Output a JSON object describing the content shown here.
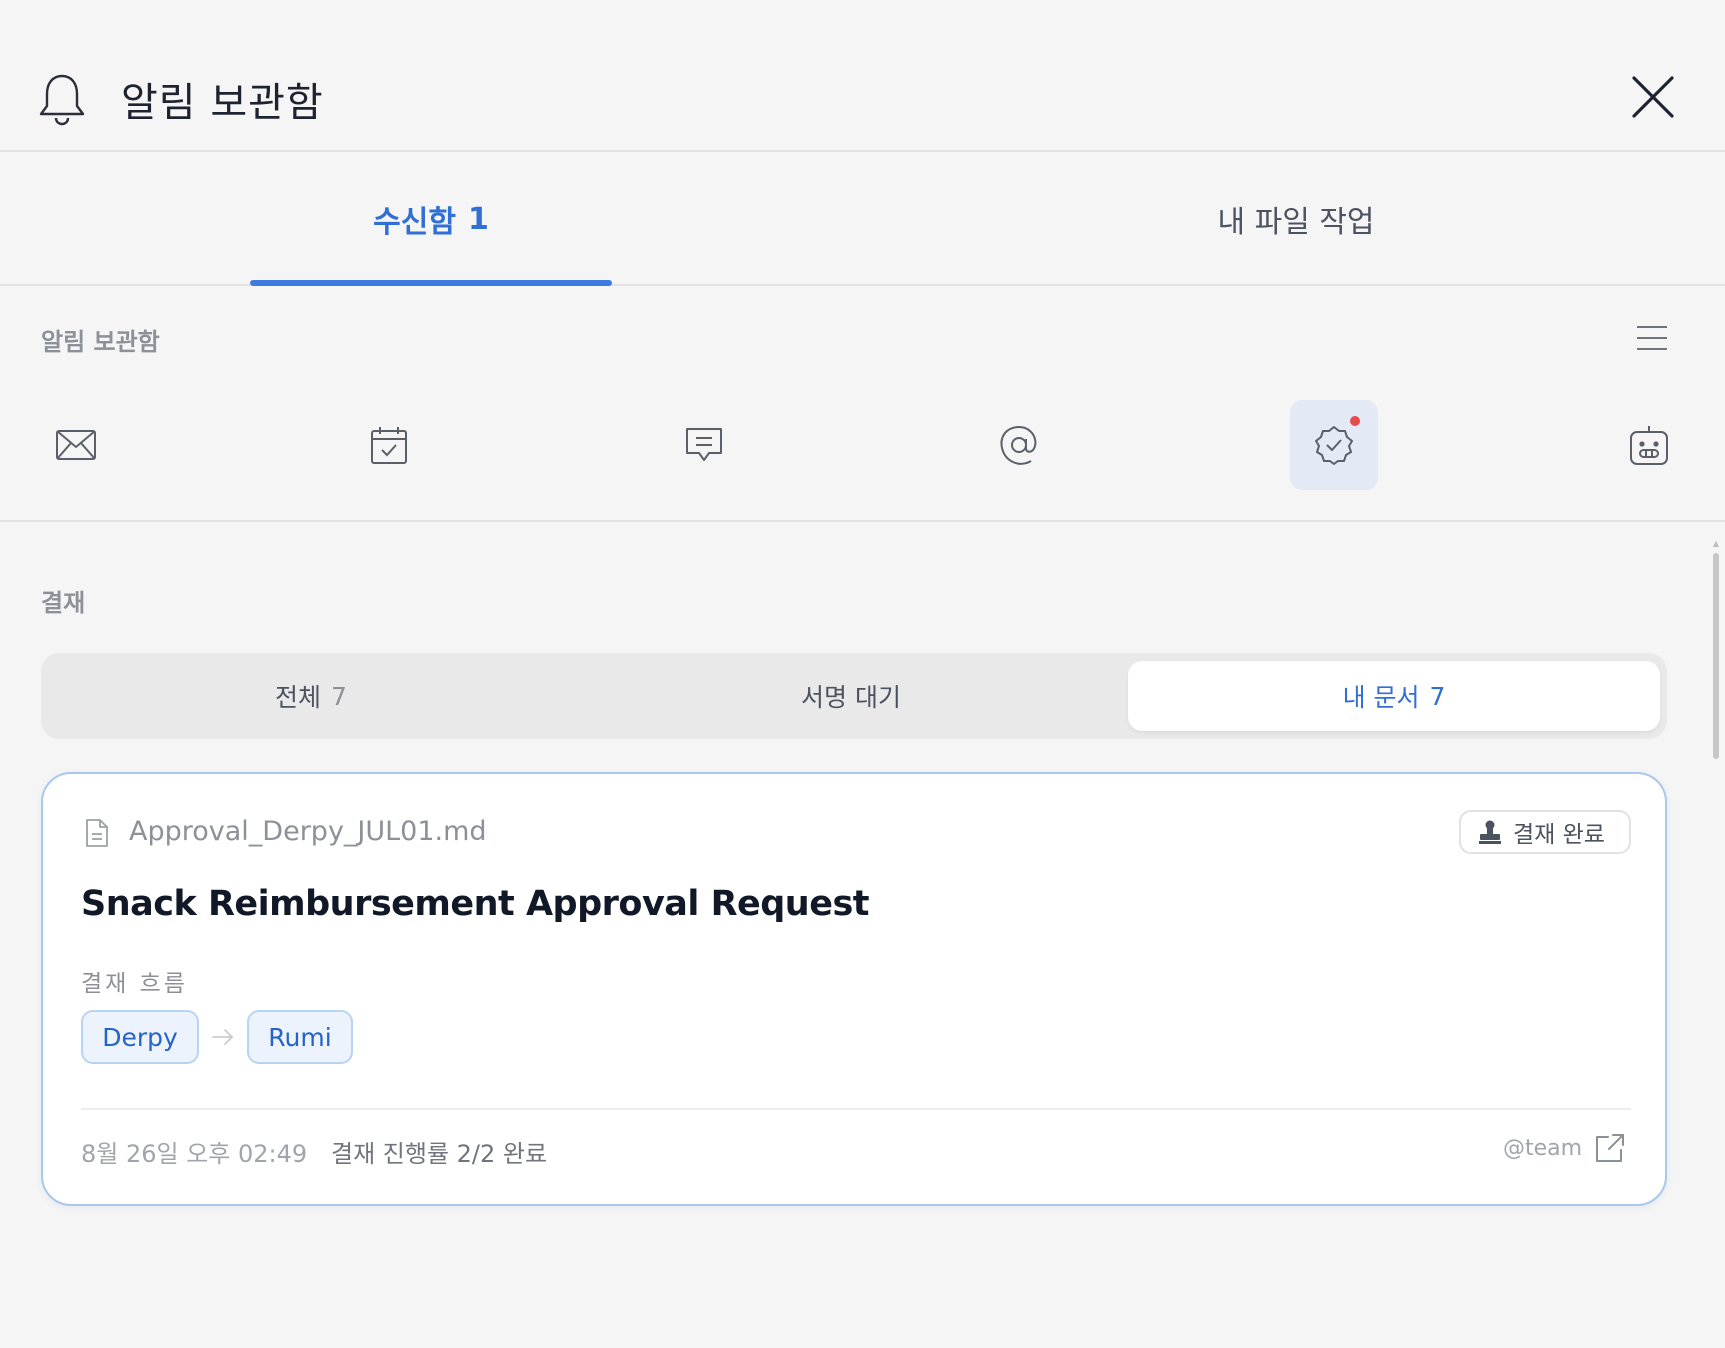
{
  "header": {
    "title": "알림 보관함"
  },
  "tabs": [
    {
      "label": "수신함",
      "count": "1"
    },
    {
      "label": "내 파일 작업"
    }
  ],
  "section": {
    "label": "알림 보관함"
  },
  "categories": [
    {
      "icon": "mail-icon"
    },
    {
      "icon": "calendar-check-icon"
    },
    {
      "icon": "comment-icon"
    },
    {
      "icon": "mention-icon"
    },
    {
      "icon": "approval-badge-icon",
      "active": true,
      "has_new": true
    },
    {
      "icon": "bot-icon"
    }
  ],
  "approval": {
    "label": "결재",
    "segments": [
      {
        "label": "전체",
        "count": "7"
      },
      {
        "label": "서명 대기",
        "count": ""
      },
      {
        "label": "내 문서",
        "count": "7",
        "selected": true
      }
    ]
  },
  "card": {
    "file_name": "Approval_Derpy_JUL01.md",
    "status": "결재 완료",
    "title": "Snack Reimbursement Approval Request",
    "flow_label": "결재 흐름",
    "flow": [
      "Derpy",
      "Rumi"
    ],
    "time": "8월 26일 오후 02:49",
    "progress": "결재 진행률 2/2 완료",
    "team": "@team"
  },
  "colors": {
    "accent": "#3d7be0",
    "background": "#f5f5f5",
    "card_border": "#a9c8ef",
    "notification_dot": "#e94b4b"
  }
}
